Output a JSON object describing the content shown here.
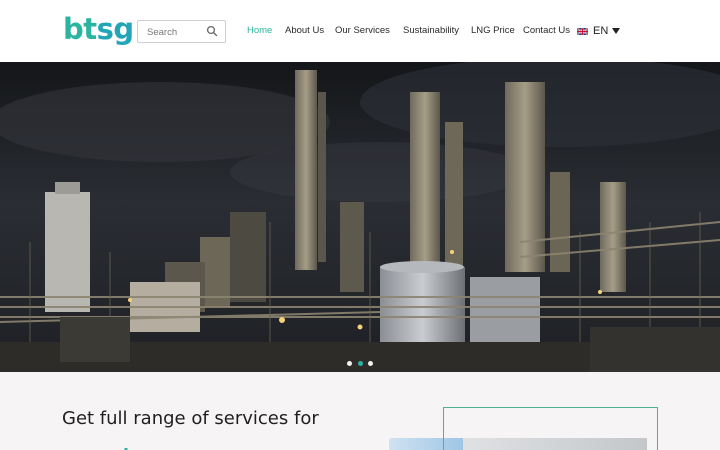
{
  "header": {
    "logo": {
      "part1": "bt",
      "part2": "sg"
    },
    "search": {
      "placeholder": "Search",
      "value": ""
    },
    "nav": [
      {
        "label": "Home",
        "active": true
      },
      {
        "label": "About Us",
        "active": false
      },
      {
        "label": "Our Services",
        "active": false
      },
      {
        "label": "Sustainability",
        "active": false
      },
      {
        "label": "LNG Price",
        "active": false
      },
      {
        "label": "Contact Us",
        "active": false
      }
    ],
    "language": {
      "label": "EN",
      "flag_icon": "uk-flag-icon"
    }
  },
  "hero": {
    "slides_count": 3,
    "active_slide": 2
  },
  "section": {
    "headline": "Get full range of services for"
  },
  "colors": {
    "brand_green": "#2bb5a0",
    "brand_teal": "#22a6b7",
    "frame_green": "#4fb48e",
    "section_bg": "#f6f4f4"
  }
}
